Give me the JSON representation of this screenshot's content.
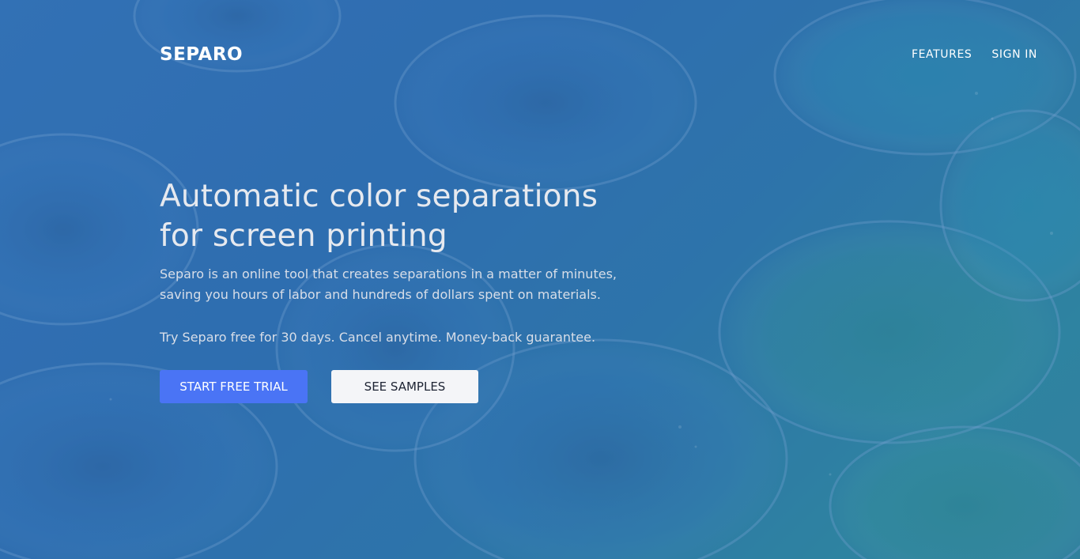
{
  "brand": {
    "logo_text": "SEPARO"
  },
  "nav": {
    "items": [
      {
        "label": "FEATURES"
      },
      {
        "label": "SIGN IN"
      }
    ]
  },
  "hero": {
    "headline": "Automatic color separations for screen printing",
    "subtext": "Separo is an online tool that creates separations in a matter of minutes, saving you hours of labor and hundreds of dollars spent on materials.",
    "trial_note": "Try Separo free for 30 days. Cancel anytime. Money-back guarantee.",
    "primary_cta": "START FREE TRIAL",
    "secondary_cta": "SEE SAMPLES"
  },
  "colors": {
    "primary_button": "#4a74f5",
    "secondary_button": "#f4f5f8",
    "overlay_blue": "#3473b7",
    "overlay_teal": "#338a98"
  }
}
